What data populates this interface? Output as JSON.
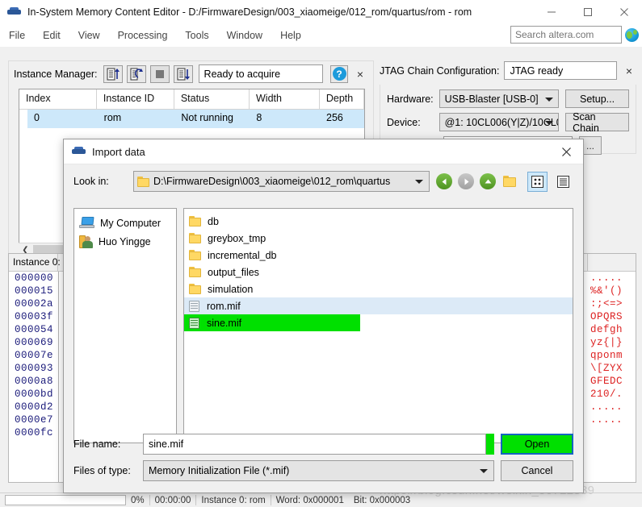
{
  "window": {
    "title": "In-System Memory Content Editor - D:/FirmwareDesign/003_xiaomeige/012_rom/quartus/rom - rom",
    "minimize_label": "minimize",
    "maximize_label": "maximize",
    "close_label": "close"
  },
  "menubar": {
    "items": [
      "File",
      "Edit",
      "View",
      "Processing",
      "Tools",
      "Window",
      "Help"
    ],
    "search_placeholder": "Search altera.com",
    "search_value": ""
  },
  "instance_manager": {
    "label": "Instance Manager:",
    "status": "Ready to acquire",
    "help_label": "?",
    "close_label": "×",
    "toolbar": [
      {
        "name": "read-data-button",
        "title": "Read data from In-System Memory"
      },
      {
        "name": "continuous-read-button",
        "title": "Continuously read data"
      },
      {
        "name": "stop-button",
        "title": "Stop"
      },
      {
        "name": "write-data-button",
        "title": "Write data to In-System Memory"
      }
    ],
    "columns": [
      "Index",
      "Instance ID",
      "Status",
      "Width",
      "Depth"
    ],
    "rows": [
      {
        "index": "0",
        "instance_id": "rom",
        "status": "Not running",
        "width": "8",
        "depth": "256"
      }
    ]
  },
  "jtag": {
    "title": "JTAG Chain Configuration:",
    "status": "JTAG ready",
    "close_label": "×",
    "hardware_label": "Hardware:",
    "hardware_value": "USB-Blaster [USB-0]",
    "setup_label": "Setup...",
    "device_label": "Device:",
    "device_value": "@1: 10CL006(Y|Z)/10CL0",
    "scan_chain_label": "Scan Chain",
    "file_value": "",
    "browse_label": "..."
  },
  "hex_editor": {
    "column_header": "Instance 0:",
    "addresses": [
      "000000",
      "000015",
      "00002a",
      "00003f",
      "000054",
      "000069",
      "00007e",
      "000093",
      "0000a8",
      "0000bd",
      "0000d2",
      "0000e7",
      "0000fc"
    ],
    "ascii_rows": [
      ".....",
      "%&'()",
      ":;<=>",
      "OPQRS",
      "defgh",
      "yz{|}",
      "qponm",
      "\\[ZYX",
      "GFEDC",
      "210/.",
      ".....",
      "....."
    ]
  },
  "statusbar": {
    "progress": "0%",
    "elapsed": "00:00:00",
    "instance": "Instance 0: rom",
    "word": "Word: 0x000001",
    "bit": "Bit: 0x000003"
  },
  "watermark": "https://blog.csdn.net/weixin_50722839",
  "dialog": {
    "title": "Import data",
    "close_label": "×",
    "lookin_label": "Look in:",
    "path": "D:\\FirmwareDesign\\003_xiaomeige\\012_rom\\quartus",
    "nav": {
      "back": "Back",
      "forward": "Forward",
      "parent": "Parent Directory",
      "new_folder": "Create New Folder",
      "list_view": "List View",
      "detail_view": "Detail View"
    },
    "places": [
      {
        "label": "My Computer",
        "icon": "computer-icon"
      },
      {
        "label": "Huo Yingge",
        "icon": "user-icon"
      }
    ],
    "files": [
      {
        "name": "db",
        "type": "folder",
        "selected": false
      },
      {
        "name": "greybox_tmp",
        "type": "folder",
        "selected": false
      },
      {
        "name": "incremental_db",
        "type": "folder",
        "selected": false
      },
      {
        "name": "output_files",
        "type": "folder",
        "selected": false
      },
      {
        "name": "simulation",
        "type": "folder",
        "selected": false
      },
      {
        "name": "rom.mif",
        "type": "file",
        "selected": false
      },
      {
        "name": "sine.mif",
        "type": "file",
        "selected": true
      }
    ],
    "filename_label": "File name:",
    "filename_value": "sine.mif",
    "filetype_label": "Files of type:",
    "filetype_value": "Memory Initialization File (*.mif)",
    "open_label": "Open",
    "cancel_label": "Cancel"
  },
  "colors": {
    "accent": "#1d9bdb",
    "selection_green": "#00e000",
    "focus_blue": "#1565c0",
    "row_select": "#cde8fa",
    "ascii_red": "#dd2222",
    "addr_blue": "#1a1a7a"
  }
}
